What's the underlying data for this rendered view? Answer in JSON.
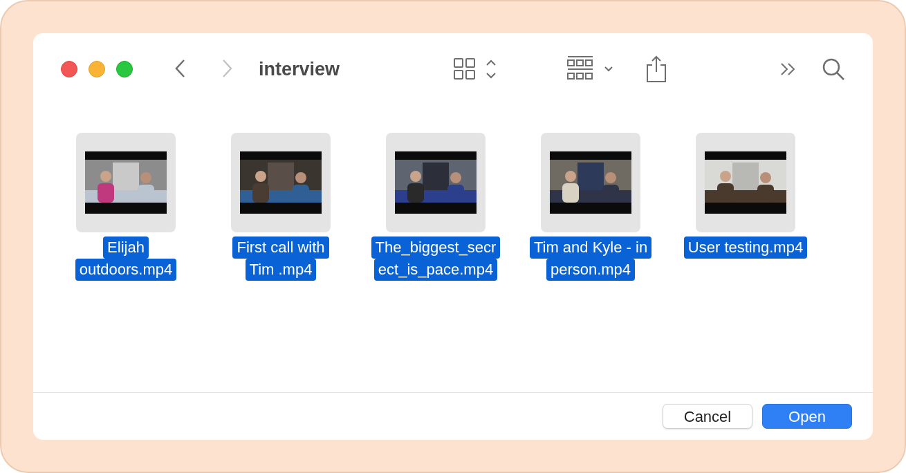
{
  "window": {
    "title": "interview"
  },
  "navigation": [
    {
      "kind": "back",
      "disabled": false
    },
    {
      "kind": "forward",
      "disabled": true
    }
  ],
  "files": [
    {
      "name_lines": [
        "Elijah",
        "outdoors.mp4"
      ],
      "selected": true,
      "kind": "picture"
    },
    {
      "name_lines": [
        "First call with",
        "Tim .mp4"
      ],
      "selected": true,
      "kind": "picture"
    },
    {
      "name_lines": [
        "The_biggest_secr",
        "ect_is_pace.mp4"
      ],
      "selected": true,
      "kind": "picture"
    },
    {
      "name_lines": [
        "Tim and Kyle - in",
        "person.mp4"
      ],
      "selected": true,
      "kind": "picture"
    },
    {
      "name_lines": [
        "User testing.mp4"
      ],
      "selected": true,
      "kind": "picture"
    }
  ],
  "buttons": [
    {
      "label": "Cancel",
      "kind": "secondary"
    },
    {
      "label": "Open",
      "kind": "primary"
    }
  ]
}
